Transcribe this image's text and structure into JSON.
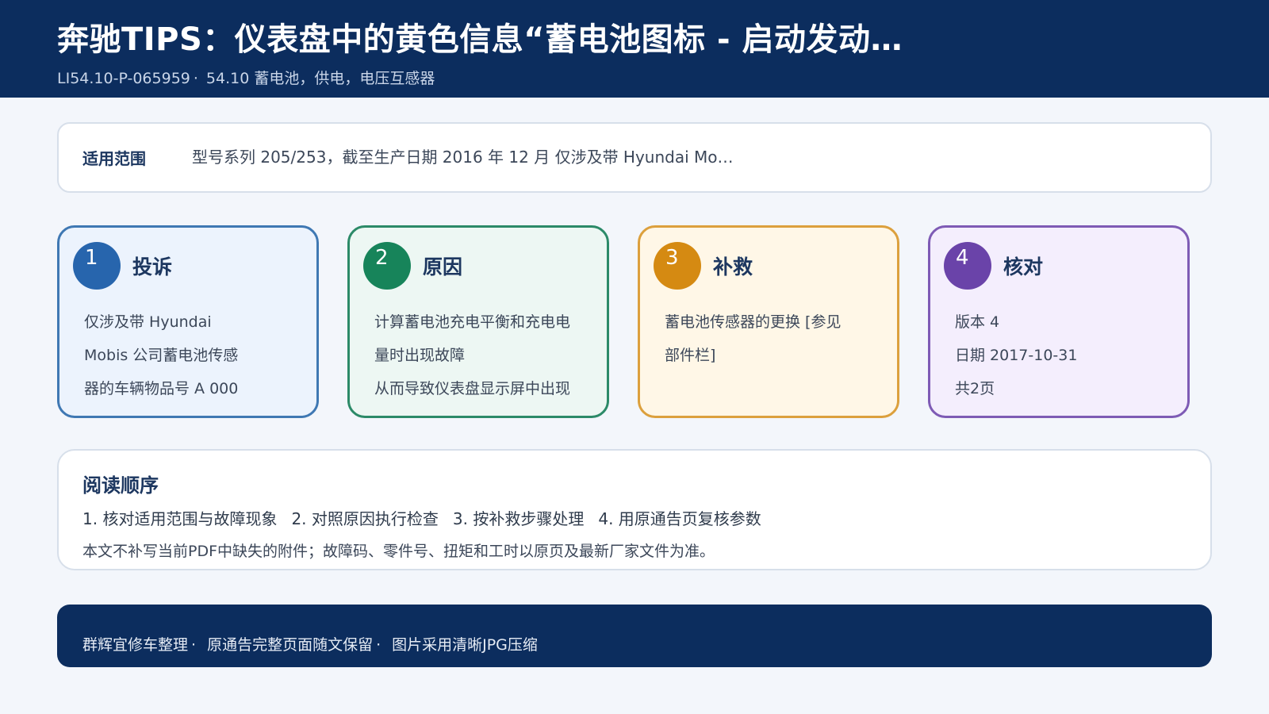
{
  "header": {
    "title": "奔驰TIPS：仪表盘中的黄色信息“蓄电池图标 - 启动发动…",
    "doc_id": "LI54.10-P-065959",
    "category": "54.10 蓄电池，供电，电压互感器"
  },
  "scope": {
    "label": "适用范围",
    "text": "型号系列 205/253，截至生产日期 2016 年 12 月 仅涉及带 Hyundai Mo…"
  },
  "cards": [
    {
      "number": "1",
      "title": "投诉",
      "lines": [
        "仅涉及带 Hyundai",
        "Mobis 公司蓄电池传感",
        "器的车辆物品号 A 000"
      ]
    },
    {
      "number": "2",
      "title": "原因",
      "lines": [
        "计算蓄电池充电平衡和充电电",
        "量时出现故障",
        "从而导致仪表盘显示屏中出现"
      ]
    },
    {
      "number": "3",
      "title": "补救",
      "lines": [
        "蓄电池传感器的更换 [参见",
        "部件栏]"
      ]
    },
    {
      "number": "4",
      "title": "核对",
      "lines": [
        "版本 4",
        "日期 2017-10-31",
        "共2页"
      ]
    }
  ],
  "reading": {
    "title": "阅读顺序",
    "steps": [
      "1. 核对适用范围与故障现象",
      "2. 对照原因执行检查",
      "3. 按补救步骤处理",
      "4. 用原通告页复核参数"
    ],
    "note": "本文不补写当前PDF中缺失的附件；故障码、零件号、扭矩和工时以原页及最新厂家文件为准。"
  },
  "footer": {
    "items": [
      "群辉宜修车整理",
      "原通告完整页面随文保留",
      "图片采用清晰JPG压缩"
    ]
  },
  "colors": {
    "header_bg": "#0c2d5e",
    "card1": "#2765ad",
    "card2": "#17845a",
    "card3": "#d58a12",
    "card4": "#6a43a9"
  }
}
